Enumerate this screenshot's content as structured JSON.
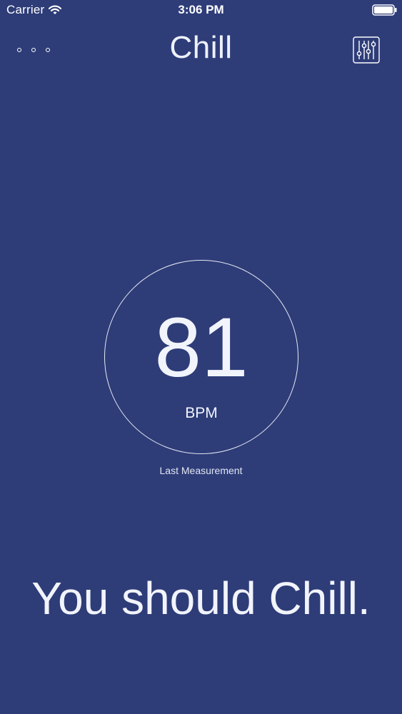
{
  "status_bar": {
    "carrier": "Carrier",
    "time": "3:06 PM",
    "wifi_icon": "wifi-icon",
    "battery_icon": "battery-icon"
  },
  "nav": {
    "title": "Chill",
    "more_icon": "ellipsis-icon",
    "settings_icon": "sliders-icon"
  },
  "meter": {
    "value": "81",
    "unit": "BPM",
    "caption": "Last Measurement"
  },
  "headline": "You should Chill.",
  "colors": {
    "background": "#2e3d78",
    "foreground": "#ffffff"
  }
}
